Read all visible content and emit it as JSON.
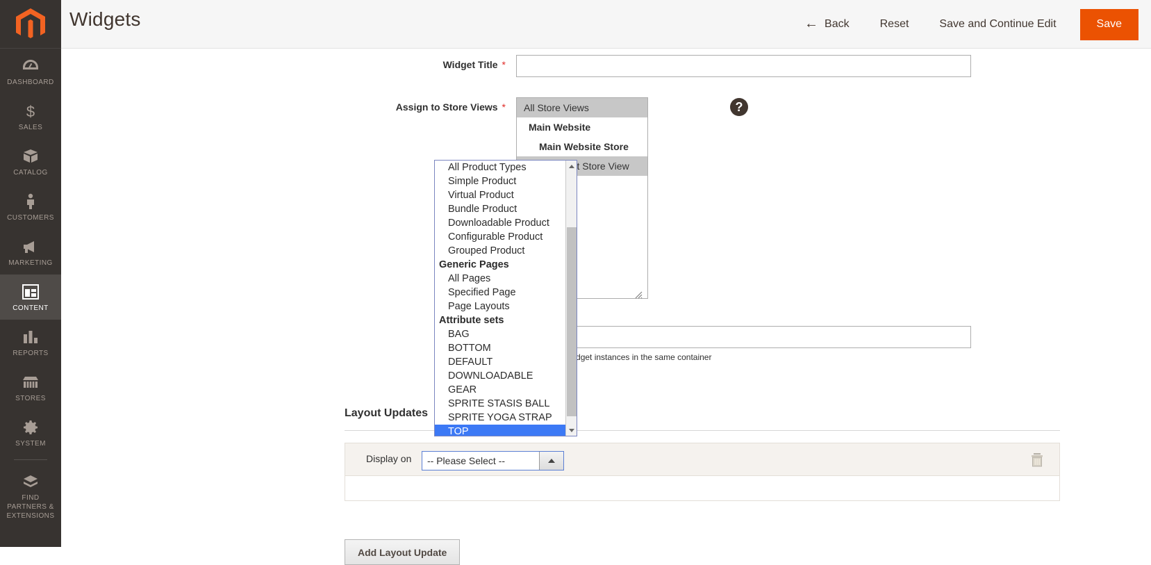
{
  "app": {
    "logo": "magento-logo"
  },
  "sidebar": {
    "items": [
      {
        "label": "DASHBOARD",
        "icon": "dashboard-icon",
        "active": false
      },
      {
        "label": "SALES",
        "icon": "dollar-icon",
        "active": false
      },
      {
        "label": "CATALOG",
        "icon": "box-icon",
        "active": false
      },
      {
        "label": "CUSTOMERS",
        "icon": "person-icon",
        "active": false
      },
      {
        "label": "MARKETING",
        "icon": "megaphone-icon",
        "active": false
      },
      {
        "label": "CONTENT",
        "icon": "layout-icon",
        "active": true
      },
      {
        "label": "REPORTS",
        "icon": "bar-chart-icon",
        "active": false
      },
      {
        "label": "STORES",
        "icon": "storefront-icon",
        "active": false
      },
      {
        "label": "SYSTEM",
        "icon": "gear-icon",
        "active": false
      },
      {
        "label": "FIND PARTNERS & EXTENSIONS",
        "icon": "extensions-icon",
        "active": false
      }
    ]
  },
  "header": {
    "title": "Widgets",
    "back_label": "Back",
    "back_arrow": "←",
    "reset_label": "Reset",
    "save_continue_label": "Save and Continue Edit",
    "save_label": "Save",
    "primary_color": "#eb5202"
  },
  "form": {
    "widget_title": {
      "label": "Widget Title",
      "required_marker": "*",
      "value": "",
      "placeholder": ""
    },
    "assign_store_views": {
      "label": "Assign to Store Views",
      "required_marker": "*",
      "options": [
        {
          "text": "All Store Views",
          "level": 0,
          "selected": true
        },
        {
          "text": "Main Website",
          "level": 1,
          "selected": false
        },
        {
          "text": "Main Website Store",
          "level": 2,
          "selected": false
        },
        {
          "text": "Default Store View",
          "level": 3,
          "selected": true
        }
      ]
    },
    "help_icon": "question-mark-icon",
    "sort_order": {
      "value": "",
      "note": "Sort Order of widget instances in the same container"
    }
  },
  "layout_updates": {
    "section_title": "Layout Updates",
    "row": {
      "label": "Display on",
      "selected_value": "-- Please Select --",
      "delete_icon": "trash-icon",
      "caret": "caret-up-icon"
    },
    "add_button_label": "Add Layout Update"
  },
  "open_dropdown": {
    "name": "display-on-options",
    "highlighted": "TOP",
    "options": [
      {
        "text": "All Product Types",
        "group": false
      },
      {
        "text": "Simple Product",
        "group": false
      },
      {
        "text": "Virtual Product",
        "group": false
      },
      {
        "text": "Bundle Product",
        "group": false
      },
      {
        "text": "Downloadable Product",
        "group": false
      },
      {
        "text": "Configurable Product",
        "group": false
      },
      {
        "text": "Grouped Product",
        "group": false
      },
      {
        "text": "Generic Pages",
        "group": true
      },
      {
        "text": "All Pages",
        "group": false
      },
      {
        "text": "Specified Page",
        "group": false
      },
      {
        "text": "Page Layouts",
        "group": false
      },
      {
        "text": "Attribute sets",
        "group": true
      },
      {
        "text": "BAG",
        "group": false
      },
      {
        "text": "BOTTOM",
        "group": false
      },
      {
        "text": "DEFAULT",
        "group": false
      },
      {
        "text": "DOWNLOADABLE",
        "group": false
      },
      {
        "text": "GEAR",
        "group": false
      },
      {
        "text": "SPRITE STASIS BALL",
        "group": false
      },
      {
        "text": "SPRITE YOGA STRAP",
        "group": false
      },
      {
        "text": "TOP",
        "group": false
      }
    ],
    "highlight_color": "#3c79f5"
  }
}
